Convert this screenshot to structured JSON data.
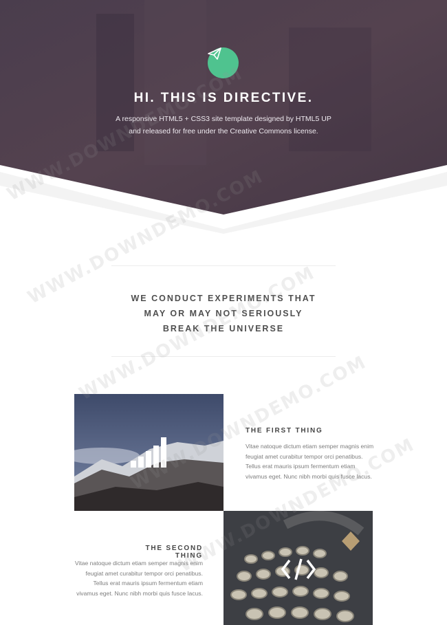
{
  "hero": {
    "logo_icon": "paper-plane-icon",
    "title": "HI. THIS IS DIRECTIVE.",
    "subtitle_line1": "A responsive HTML5 + CSS3 site template designed by HTML5 UP",
    "subtitle_line2": "and released for free under the Creative Commons license."
  },
  "intro": {
    "line1": "WE CONDUCT EXPERIMENTS THAT",
    "line2": "MAY OR MAY NOT SERIOUSLY",
    "line3": "BREAK THE UNIVERSE"
  },
  "features": [
    {
      "title": "THE FIRST THING",
      "icon": "bar-chart-icon",
      "text1": "Vitae natoque dictum etiam semper magnis enim",
      "text2": "feugiat amet curabitur tempor orci penatibus.",
      "text3": "Tellus erat mauris ipsum fermentum etiam",
      "text4": "vivamus eget. Nunc nibh morbi quis fusce lacus."
    },
    {
      "title": "THE SECOND THING",
      "icon": "code-icon",
      "text1": "Vitae natoque dictum etiam semper magnis enim",
      "text2": "feugiat amet curabitur tempor orci penatibus.",
      "text3": "Tellus erat mauris ipsum fermentum etiam",
      "text4": "vivamus eget. Nunc nibh morbi quis fusce lacus."
    }
  ],
  "watermark": "WWW.DOWNDEMO.COM",
  "colors": {
    "header": "#4a3b4a",
    "accent": "#4fc38f",
    "text_dark": "#4f4f4f",
    "text_light": "#7d7d7d"
  }
}
